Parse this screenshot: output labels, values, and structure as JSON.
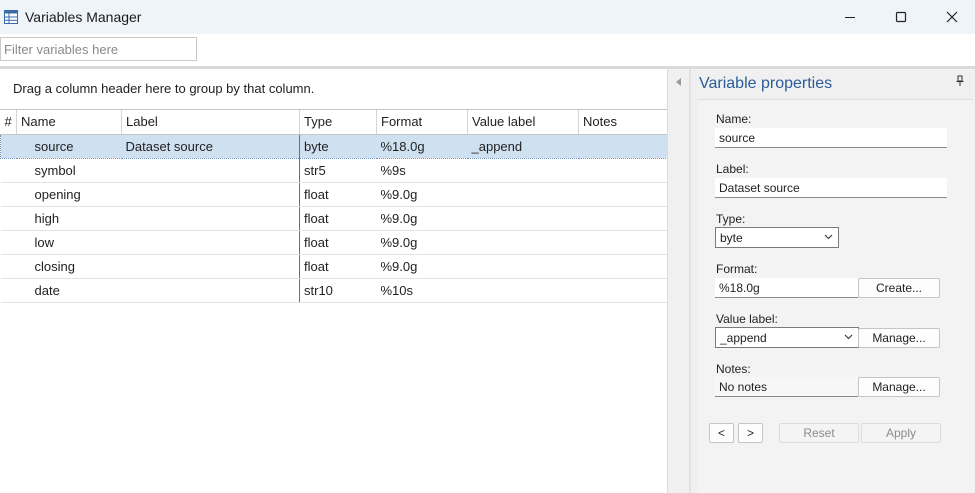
{
  "window": {
    "title": "Variables Manager",
    "icon": "spreadsheet-icon",
    "controls": [
      "minimize-icon",
      "maximize-icon",
      "close-icon"
    ]
  },
  "filter": {
    "placeholder": "Filter variables here",
    "value": ""
  },
  "grid": {
    "group_hint": "Drag a column header here to group by that column.",
    "columns": [
      "#",
      "Name",
      "Label",
      "Type",
      "Format",
      "Value label",
      "Notes"
    ],
    "rows": [
      {
        "name": "source",
        "label": "Dataset source",
        "type": "byte",
        "format": "%18.0g",
        "value_label": "_append",
        "notes": ""
      },
      {
        "name": "symbol",
        "label": "",
        "type": "str5",
        "format": "%9s",
        "value_label": "",
        "notes": ""
      },
      {
        "name": "opening",
        "label": "",
        "type": "float",
        "format": "%9.0g",
        "value_label": "",
        "notes": ""
      },
      {
        "name": "high",
        "label": "",
        "type": "float",
        "format": "%9.0g",
        "value_label": "",
        "notes": ""
      },
      {
        "name": "low",
        "label": "",
        "type": "float",
        "format": "%9.0g",
        "value_label": "",
        "notes": ""
      },
      {
        "name": "closing",
        "label": "",
        "type": "float",
        "format": "%9.0g",
        "value_label": "",
        "notes": ""
      },
      {
        "name": "date",
        "label": "",
        "type": "str10",
        "format": "%10s",
        "value_label": "",
        "notes": ""
      }
    ],
    "selected_row": 0
  },
  "properties": {
    "title": "Variable properties",
    "name_label": "Name:",
    "name_value": "source",
    "label_label": "Label:",
    "label_value": "Dataset source",
    "type_label": "Type:",
    "type_value": "byte",
    "format_label": "Format:",
    "format_value": "%18.0g",
    "create_button": "Create...",
    "value_label_label": "Value label:",
    "value_label_value": "_append",
    "manage_button": "Manage...",
    "notes_label": "Notes:",
    "notes_value": "No notes",
    "notes_manage_button": "Manage...",
    "prev_button": "<",
    "next_button": ">",
    "reset_button": "Reset",
    "apply_button": "Apply"
  },
  "colors": {
    "accent_title": "#2c5c98",
    "selection": "#cfe0f1",
    "panel_bg": "#f0f0f0"
  }
}
